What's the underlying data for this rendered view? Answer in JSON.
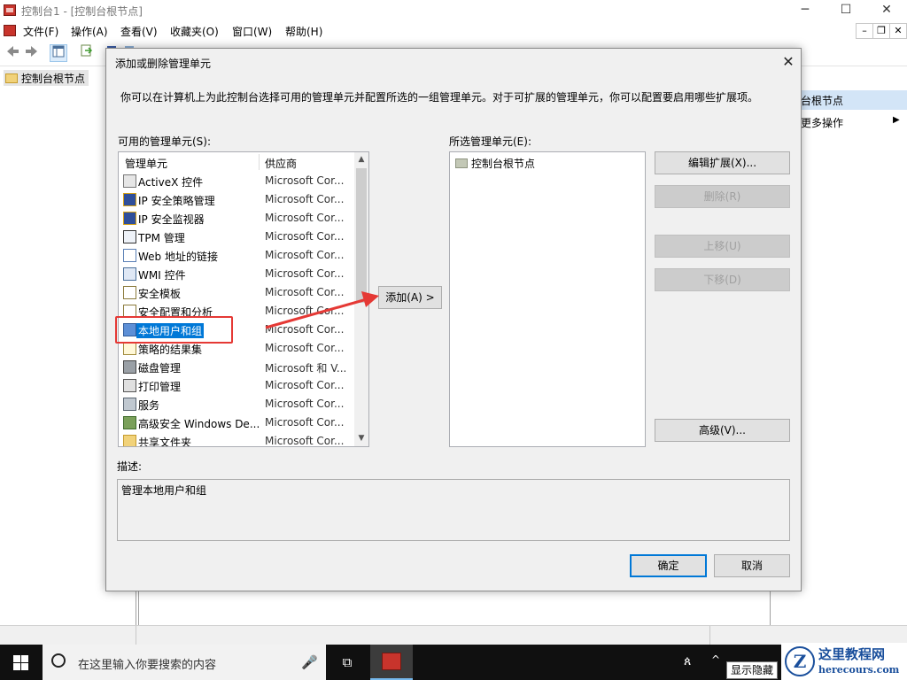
{
  "window": {
    "title": "控制台1 - [控制台根节点]",
    "controls": {
      "minimize": "─",
      "maximize": "☐",
      "close": "✕"
    },
    "menu": [
      "文件(F)",
      "操作(A)",
      "查看(V)",
      "收藏夹(O)",
      "窗口(W)",
      "帮助(H)"
    ],
    "mdi_controls": {
      "minimize": "–",
      "restore": "❐",
      "close": "✕"
    }
  },
  "tree": {
    "root": "控制台根节点"
  },
  "actions": {
    "header": "台根节点",
    "more": "更多操作",
    "more_arrow": "▶"
  },
  "dialog": {
    "title": "添加或删除管理单元",
    "close": "✕",
    "description": "你可以在计算机上为此控制台选择可用的管理单元并配置所选的一组管理单元。对于可扩展的管理单元，你可以配置要启用哪些扩展项。",
    "available_label": "可用的管理单元(S):",
    "columns": {
      "name": "管理单元",
      "vendor": "供应商"
    },
    "available": [
      {
        "name": "ActiveX 控件",
        "vendor": "Microsoft Cor...",
        "icon": "activex-icon"
      },
      {
        "name": "IP 安全策略管理",
        "vendor": "Microsoft Cor...",
        "icon": "ipsec-policy-icon"
      },
      {
        "name": "IP 安全监视器",
        "vendor": "Microsoft Cor...",
        "icon": "ipsec-monitor-icon"
      },
      {
        "name": "TPM 管理",
        "vendor": "Microsoft Cor...",
        "icon": "tpm-icon"
      },
      {
        "name": "Web 地址的链接",
        "vendor": "Microsoft Cor...",
        "icon": "web-link-icon"
      },
      {
        "name": "WMI 控件",
        "vendor": "Microsoft Cor...",
        "icon": "wmi-icon"
      },
      {
        "name": "安全模板",
        "vendor": "Microsoft Cor...",
        "icon": "security-template-icon"
      },
      {
        "name": "安全配置和分析",
        "vendor": "Microsoft Cor...",
        "icon": "security-config-icon"
      },
      {
        "name": "本地用户和组",
        "vendor": "Microsoft Cor...",
        "icon": "users-groups-icon",
        "selected": true
      },
      {
        "name": "策略的结果集",
        "vendor": "Microsoft Cor...",
        "icon": "rsop-icon"
      },
      {
        "name": "磁盘管理",
        "vendor": "Microsoft 和 V...",
        "icon": "disk-icon"
      },
      {
        "name": "打印管理",
        "vendor": "Microsoft Cor...",
        "icon": "printer-icon"
      },
      {
        "name": "服务",
        "vendor": "Microsoft Cor...",
        "icon": "services-gear-icon"
      },
      {
        "name": "高级安全 Windows De...",
        "vendor": "Microsoft Cor...",
        "icon": "firewall-icon"
      },
      {
        "name": "共享文件夹",
        "vendor": "Microsoft Cor...",
        "icon": "shared-folder-icon"
      }
    ],
    "scroll": {
      "up": "▲",
      "down": "▼"
    },
    "add_button": "添加(A) >",
    "selected_label": "所选管理单元(E):",
    "selected": [
      "控制台根节点"
    ],
    "buttons": {
      "edit_ext": "编辑扩展(X)...",
      "remove": "删除(R)",
      "move_up": "上移(U)",
      "move_down": "下移(D)",
      "advanced": "高级(V)...",
      "ok": "确定",
      "cancel": "取消"
    },
    "desc_label": "描述:",
    "desc_text": "管理本地用户和组"
  },
  "taskbar": {
    "search_placeholder": "在这里输入你要搜索的内容",
    "mic": "🎤",
    "taskview": "⧉",
    "tray_people": "ጰ",
    "tray_arrow": "^",
    "tooltip": "显示隐藏"
  },
  "watermark": {
    "logo": "Z",
    "site_name": "这里教程网",
    "url": "herecours.com"
  },
  "colors": {
    "selection": "#0078d7",
    "annotation": "#e53935",
    "taskbar": "#101010"
  }
}
